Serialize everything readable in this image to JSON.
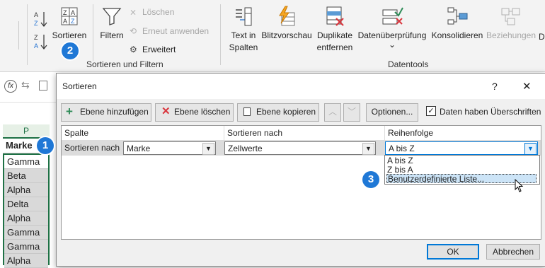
{
  "ribbon": {
    "sort_az_icon": "sort-a-z-icon",
    "sort_za_icon": "sort-z-a-icon",
    "sort_label": "Sortieren",
    "filter_label": "Filtern",
    "clear_label": "Löschen",
    "reapply_label": "Erneut anwenden",
    "advanced_label": "Erweitert",
    "group_sort_filter": "Sortieren und Filtern",
    "text_columns_line1": "Text in",
    "text_columns_line2": "Spalten",
    "flash_fill_label": "Blitzvorschau",
    "duplicates_line1": "Duplikate",
    "duplicates_line2": "entfernen",
    "validation_label": "Datenüberprüfung",
    "validation_chevron": "⌄",
    "consolidate_label": "Konsolidieren",
    "relations_label": "Beziehungen",
    "cut_label": "D",
    "group_datatools": "Datentools"
  },
  "badges": {
    "b1": "1",
    "b2": "2",
    "b3": "3"
  },
  "sheet": {
    "column_letter": "P",
    "header": "Marke",
    "values": [
      "Gamma",
      "Beta",
      "Alpha",
      "Delta",
      "Alpha",
      "Gamma",
      "Gamma",
      "Alpha"
    ]
  },
  "dialog": {
    "title": "Sortieren",
    "help": "?",
    "close": "✕",
    "add_level": "Ebene hinzufügen",
    "delete_level": "Ebene löschen",
    "copy_level": "Ebene kopieren",
    "options": "Optionen...",
    "has_headers": "Daten haben Überschriften",
    "col_header": "Spalte",
    "sorton_header": "Sortieren nach",
    "order_header": "Reihenfolge",
    "row_label": "Sortieren nach",
    "column_value": "Marke",
    "sorton_value": "Zellwerte",
    "order_value": "A bis Z",
    "order_options": [
      "A bis Z",
      "Z bis A",
      "Benutzerdefinierte Liste..."
    ],
    "ok": "OK",
    "cancel": "Abbrechen"
  }
}
